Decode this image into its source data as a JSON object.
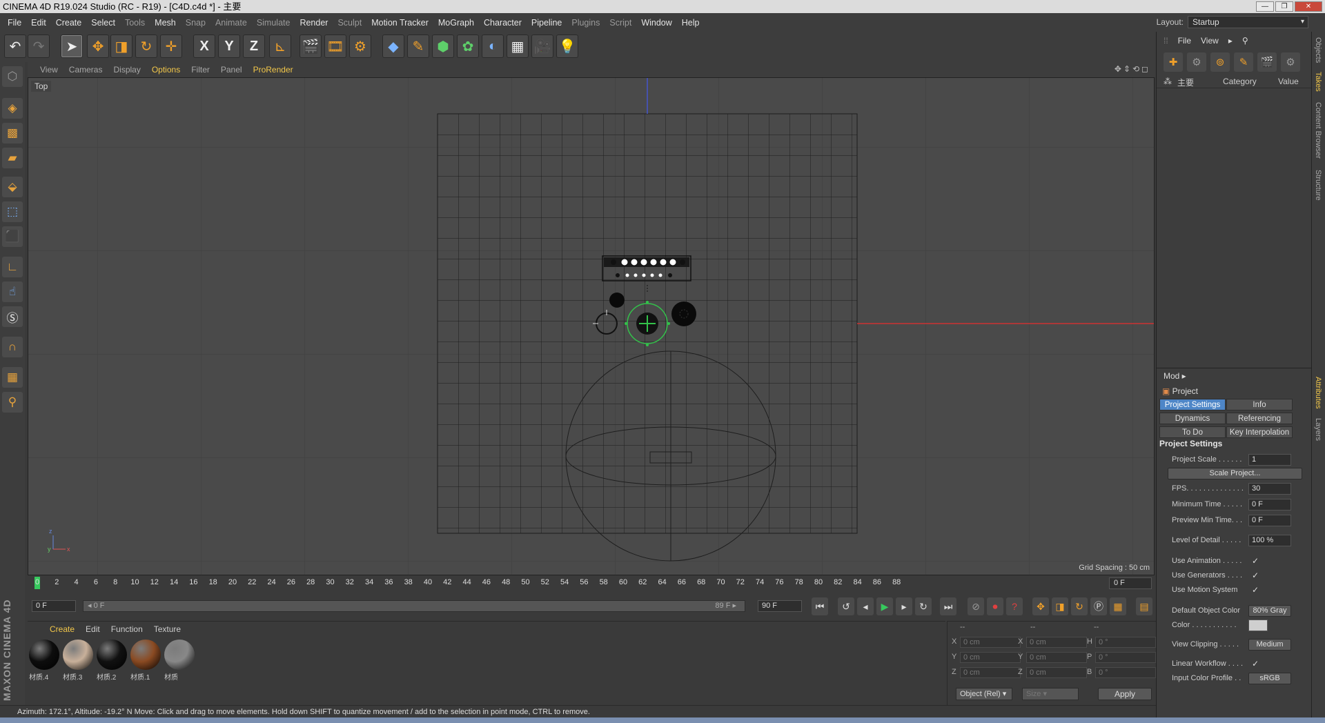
{
  "window": {
    "title": "CINEMA 4D R19.024 Studio (RC - R19) - [C4D.c4d *] - 主要",
    "buttons": [
      "—",
      "❐",
      "✕"
    ]
  },
  "menu": [
    {
      "label": "File",
      "dim": false
    },
    {
      "label": "Edit",
      "dim": false
    },
    {
      "label": "Create",
      "dim": false
    },
    {
      "label": "Select",
      "dim": false
    },
    {
      "label": "Tools",
      "dim": true
    },
    {
      "label": "Mesh",
      "dim": false
    },
    {
      "label": "Snap",
      "dim": true
    },
    {
      "label": "Animate",
      "dim": true
    },
    {
      "label": "Simulate",
      "dim": true
    },
    {
      "label": "Render",
      "dim": false
    },
    {
      "label": "Sculpt",
      "dim": true
    },
    {
      "label": "Motion Tracker",
      "dim": false
    },
    {
      "label": "MoGraph",
      "dim": false
    },
    {
      "label": "Character",
      "dim": false
    },
    {
      "label": "Pipeline",
      "dim": false
    },
    {
      "label": "Plugins",
      "dim": true
    },
    {
      "label": "Script",
      "dim": true
    },
    {
      "label": "Window",
      "dim": false
    },
    {
      "label": "Help",
      "dim": false
    }
  ],
  "layout": {
    "label": "Layout:",
    "value": "Startup"
  },
  "toolbar": {
    "undo": "↶",
    "redo": "↷",
    "x_axis": "X",
    "y_axis": "Y",
    "z_axis": "Z"
  },
  "viewport": {
    "menu": [
      "View",
      "Cameras",
      "Display",
      "Options",
      "Filter",
      "Panel",
      "ProRender"
    ],
    "highlight": [
      "Options",
      "ProRender"
    ],
    "label": "Top",
    "grid_spacing": "Grid Spacing : 50 cm"
  },
  "timeline": {
    "ticks": [
      "0",
      "2",
      "4",
      "6",
      "8",
      "10",
      "12",
      "14",
      "16",
      "18",
      "20",
      "22",
      "24",
      "26",
      "28",
      "30",
      "32",
      "34",
      "36",
      "38",
      "40",
      "42",
      "44",
      "46",
      "48",
      "50",
      "52",
      "54",
      "56",
      "58",
      "60",
      "62",
      "64",
      "66",
      "68",
      "70",
      "72",
      "74",
      "76",
      "78",
      "80",
      "82",
      "84",
      "86",
      "88"
    ],
    "current_frame": "0 F",
    "start": "0 F",
    "range_start": "0 F",
    "range_end": "89 F",
    "end": "90 F"
  },
  "materials": {
    "menu": [
      "Create",
      "Edit",
      "Function",
      "Texture"
    ],
    "items": [
      {
        "label": "材质.4",
        "color": "#0d0d0d"
      },
      {
        "label": "材质.3",
        "color": "#c8b09a"
      },
      {
        "label": "材质.2",
        "color": "#111111"
      },
      {
        "label": "材质.1",
        "color": "#8a4a22"
      },
      {
        "label": "材质",
        "color": "#888888"
      }
    ]
  },
  "coords": {
    "headers": [
      "--",
      "--",
      "--"
    ],
    "rows": [
      {
        "a": "X",
        "av": "0 cm",
        "b": "X",
        "bv": "0 cm",
        "c": "H",
        "cv": "0 °"
      },
      {
        "a": "Y",
        "av": "0 cm",
        "b": "Y",
        "bv": "0 cm",
        "c": "P",
        "cv": "0 °"
      },
      {
        "a": "Z",
        "av": "0 cm",
        "b": "Z",
        "bv": "0 cm",
        "c": "B",
        "cv": "0 °"
      }
    ],
    "mode": "Object (Rel)",
    "size": "Size",
    "apply": "Apply"
  },
  "status": "Azimuth: 172.1°, Altitude: -19.2°  N    Move: Click and drag to move elements. Hold down SHIFT to quantize movement / add to the selection in point mode, CTRL to remove.",
  "brand": "MAXON CINEMA 4D",
  "objects_panel": {
    "menu": [
      "File",
      "View"
    ],
    "tree_item": "主要",
    "col_category": "Category",
    "col_value": "Value"
  },
  "attributes": {
    "menu": "Mod",
    "title": "Project",
    "tabs": [
      "Project Settings",
      "Info",
      "Dynamics",
      "Referencing",
      "To Do",
      "Key Interpolation"
    ],
    "section": "Project Settings",
    "scale_button": "Scale Project...",
    "rows": [
      {
        "label": "Project Scale . . . . . .",
        "value": "1",
        "kind": "field"
      },
      {
        "label": "FPS. . . . . . . . . . . . . .",
        "value": "30",
        "kind": "field"
      },
      {
        "label": "Minimum Time . . . . .",
        "value": "0 F",
        "kind": "field"
      },
      {
        "label": "Preview Min Time. . .",
        "value": "0 F",
        "kind": "field"
      },
      {
        "label": "Level of Detail . . . . .",
        "value": "100 %",
        "kind": "field"
      },
      {
        "label": "Use Animation . . . . .",
        "value": "✓",
        "kind": "check"
      },
      {
        "label": "Use Generators . . . .",
        "value": "✓",
        "kind": "check"
      },
      {
        "label": "Use Motion System",
        "value": "✓",
        "kind": "check"
      },
      {
        "label": "Default Object Color",
        "value": "80% Gray",
        "kind": "button"
      },
      {
        "label": "Color . . . . . . . . . . .",
        "value": "",
        "kind": "swatch"
      },
      {
        "label": "View Clipping . . . . .",
        "value": "Medium",
        "kind": "button"
      },
      {
        "label": "Linear Workflow . . . .",
        "value": "✓",
        "kind": "check"
      },
      {
        "label": "Input Color Profile . .",
        "value": "sRGB",
        "kind": "button"
      }
    ]
  },
  "side_tabs": [
    "Objects",
    "Takes",
    "Content Browser",
    "Structure",
    "Attributes",
    "Layers"
  ],
  "colors": {
    "accent": "#f3c84a",
    "tab_active": "#4e86c7",
    "playhead": "#36c95d"
  }
}
